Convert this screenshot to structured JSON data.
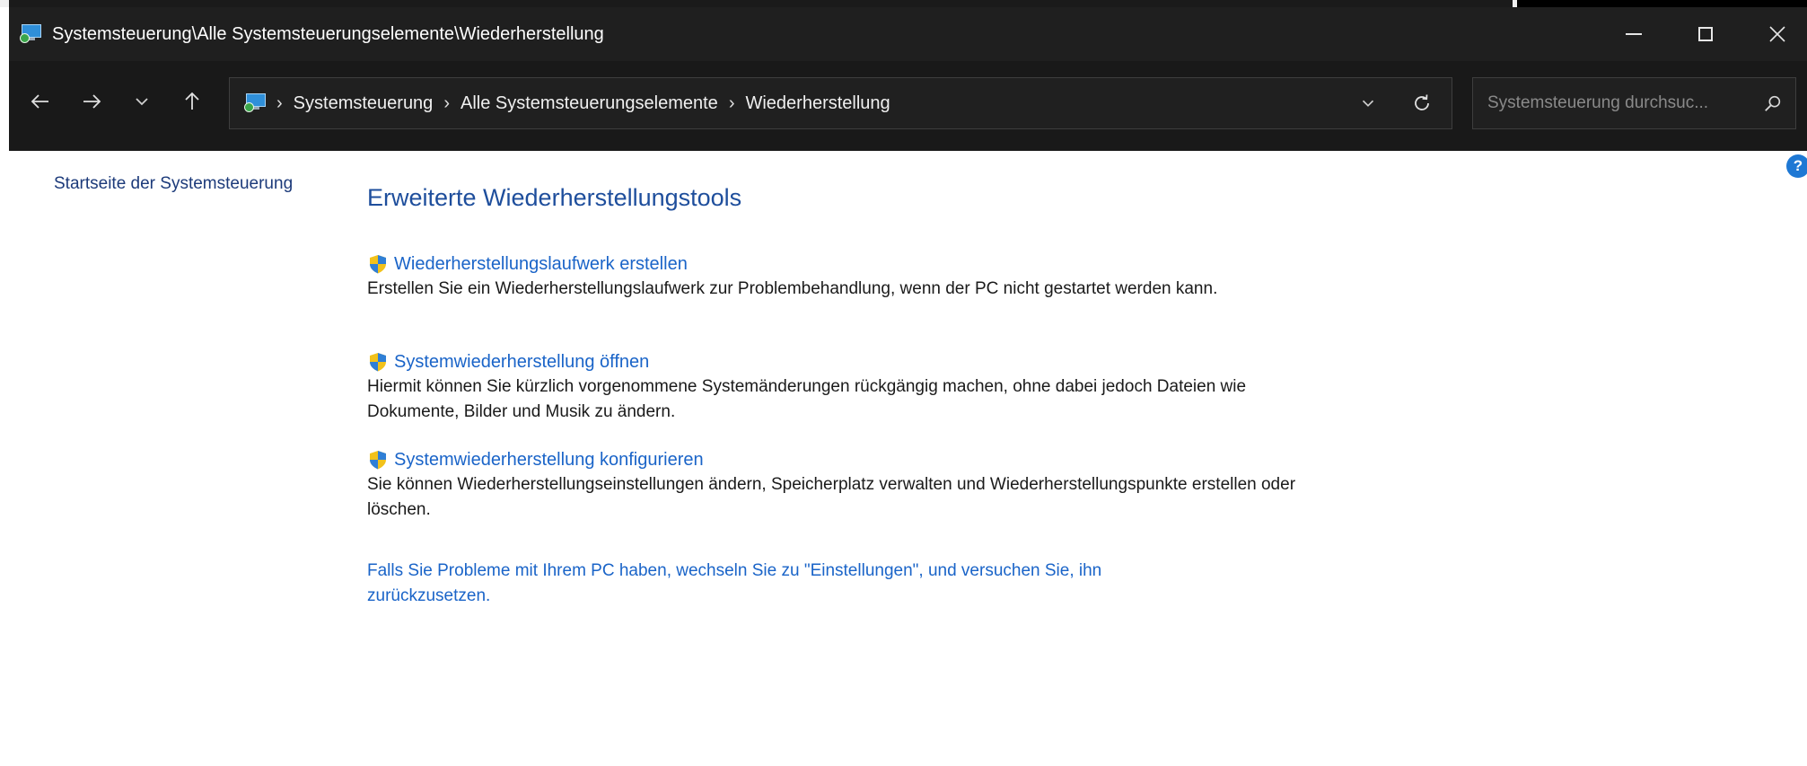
{
  "window": {
    "title": "Systemsteuerung\\Alle Systemsteuerungselemente\\Wiederherstellung",
    "controls": [
      "minimize-icon",
      "maximize-icon",
      "close-icon"
    ]
  },
  "nav": {
    "buttons": [
      "back-arrow-icon",
      "forward-arrow-icon",
      "chevron-down-icon",
      "up-arrow-icon"
    ],
    "breadcrumb": [
      "Systemsteuerung",
      "Alle Systemsteuerungselemente",
      "Wiederherstellung"
    ],
    "separator": "›",
    "search_placeholder": "Systemsteuerung durchsuc..."
  },
  "sidebar": {
    "home_link": "Startseite der Systemsteuerung"
  },
  "help_label": "?",
  "main": {
    "title": "Erweiterte Wiederherstellungstools",
    "tasks": [
      {
        "link": "Wiederherstellungslaufwerk erstellen",
        "description": "Erstellen Sie ein Wiederherstellungslaufwerk zur Problembehandlung, wenn der PC nicht gestartet werden kann."
      },
      {
        "link": "Systemwiederherstellung öffnen",
        "description": "Hiermit können Sie kürzlich vorgenommene Systemänderungen rückgängig machen, ohne dabei jedoch Dateien wie Dokumente, Bilder und Musik zu ändern."
      },
      {
        "link": "Systemwiederherstellung konfigurieren",
        "description": "Sie können Wiederherstellungseinstellungen ändern, Speicherplatz verwalten und Wiederherstellungspunkte erstellen oder löschen."
      }
    ],
    "reset_link": "Falls Sie Probleme mit Ihrem PC haben, wechseln Sie zu \"Einstellungen\", und versuchen Sie, ihn zurückzusetzen."
  },
  "colors": {
    "titlebar": "#1f1f1f",
    "navbar": "#191919",
    "link": "#1a64c8",
    "heading": "#1e4e9c",
    "text": "#1a1a1a"
  }
}
